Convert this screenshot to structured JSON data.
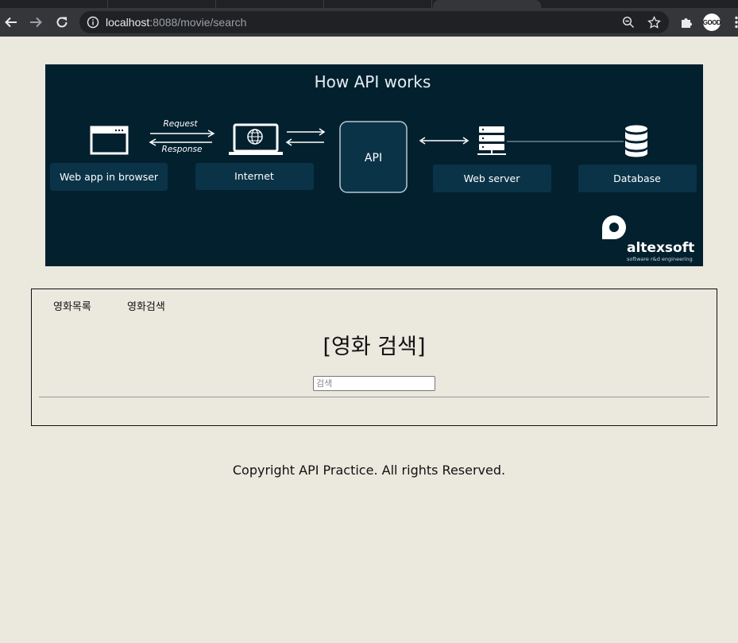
{
  "browser": {
    "url_host": "localhost",
    "url_path": ":8088/movie/search",
    "profile_badge": "GOOD"
  },
  "banner": {
    "title": "How API works",
    "request_label": "Request",
    "response_label": "Response",
    "nodes": {
      "web_app": "Web app in browser",
      "internet": "Internet",
      "api": "API",
      "web_server": "Web server",
      "database": "Database"
    },
    "brand": "altexsoft",
    "brand_tagline": "software r&d engineering"
  },
  "nav": {
    "items": [
      "영화목록",
      "영화검색"
    ]
  },
  "main": {
    "title": "[영화 검색]",
    "search_placeholder": "검색",
    "search_value": ""
  },
  "footer": {
    "text": "Copyright API Practice. All rights Reserved."
  },
  "colors": {
    "page_background": "#ebe8de",
    "banner_background": "#03202f",
    "banner_box": "#0a3347"
  }
}
